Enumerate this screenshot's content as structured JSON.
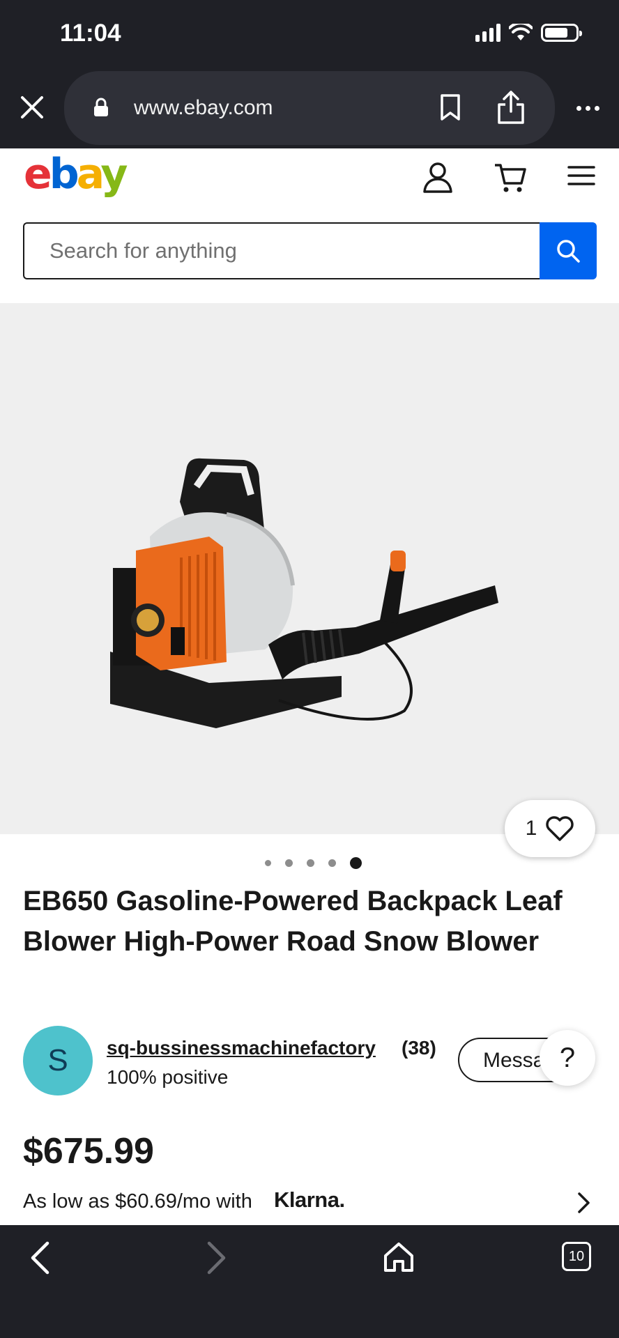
{
  "status_bar": {
    "time": "11:04"
  },
  "browser": {
    "url": "www.ebay.com",
    "open_tabs": "10"
  },
  "header": {
    "logo": {
      "e": "e",
      "b": "b",
      "a": "a",
      "y": "y"
    },
    "search_placeholder": "Search for anything"
  },
  "gallery": {
    "watch_count": "1",
    "image_count": 5,
    "active_image_index": 5
  },
  "product": {
    "title": "EB650 Gasoline-Powered Backpack Leaf Blower High-Power Road Snow Blower",
    "price": "$675.99",
    "financing_text": "As low as $60.69/mo with",
    "financing_brand": "Klarna."
  },
  "seller": {
    "initial": "S",
    "name": "sq-bussinessmachinefactory",
    "feedback_count": "(38)",
    "feedback_percent": "100% positive",
    "message_label": "Message",
    "help_label": "?"
  },
  "colors": {
    "brand_blue": "#0064f0",
    "avatar_bg": "#4ec2cc",
    "chrome_bg": "#1f2026"
  }
}
